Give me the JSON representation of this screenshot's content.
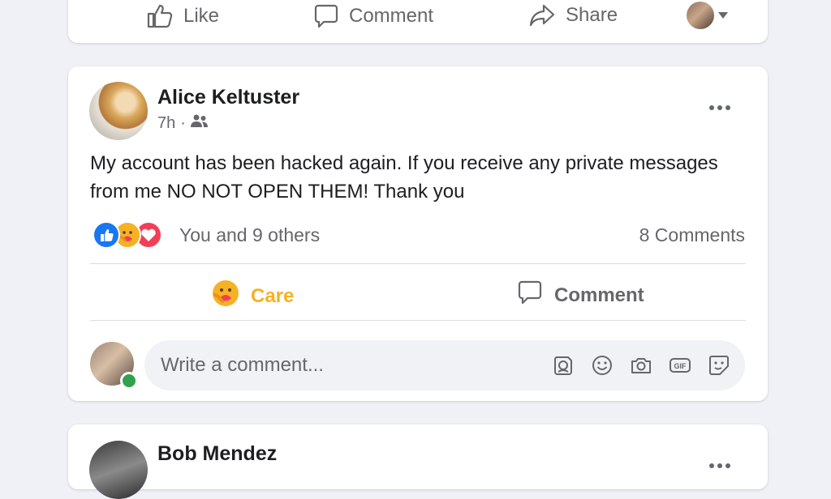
{
  "top_post": {
    "like_label": "Like",
    "comment_label": "Comment",
    "share_label": "Share"
  },
  "post": {
    "author": "Alice Keltuster",
    "time": "7h",
    "separator": "·",
    "audience_icon": "friends-icon",
    "text": "My account has been hacked again. If you receive any private messages from me NO NOT OPEN THEM! Thank you",
    "reactions": [
      "like-reaction",
      "care-reaction",
      "love-reaction"
    ],
    "reactions_text": "You and 9 others",
    "comments_count": "8 Comments",
    "care_label": "Care",
    "comment_label": "Comment",
    "comment_placeholder": "Write a comment...",
    "input_icons": [
      "avatar-sticker-icon",
      "emoji-icon",
      "camera-icon",
      "gif-icon",
      "sticker-icon"
    ]
  },
  "next_post": {
    "author": "Bob Mendez"
  },
  "colors": {
    "background": "#f0f1f6",
    "care": "#f7b125",
    "like_blue": "#1877f2",
    "love_red": "#f33e58",
    "online": "#31a24c"
  }
}
